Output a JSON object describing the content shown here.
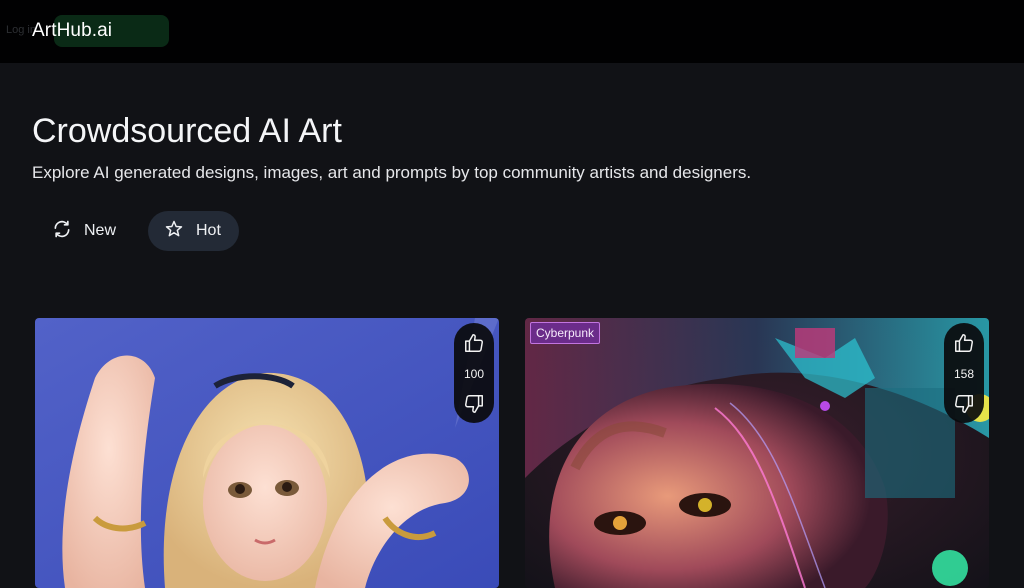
{
  "header": {
    "brand": "ArtHub.ai",
    "login_label": "Log in"
  },
  "hero": {
    "title": "Crowdsourced AI Art",
    "subtitle": "Explore AI generated designs, images, art and prompts by top community artists and designers."
  },
  "filters": [
    {
      "label": "New",
      "icon": "refresh-icon",
      "active": false
    },
    {
      "label": "Hot",
      "icon": "star-icon",
      "active": true
    }
  ],
  "cards": [
    {
      "tag": "",
      "votes": "100"
    },
    {
      "tag": "Cyberpunk",
      "votes": "158"
    }
  ],
  "colors": {
    "background": "#111216",
    "topbar": "#010102",
    "active_filter": "#232a36",
    "tag_bg": "#6b2c8a"
  }
}
